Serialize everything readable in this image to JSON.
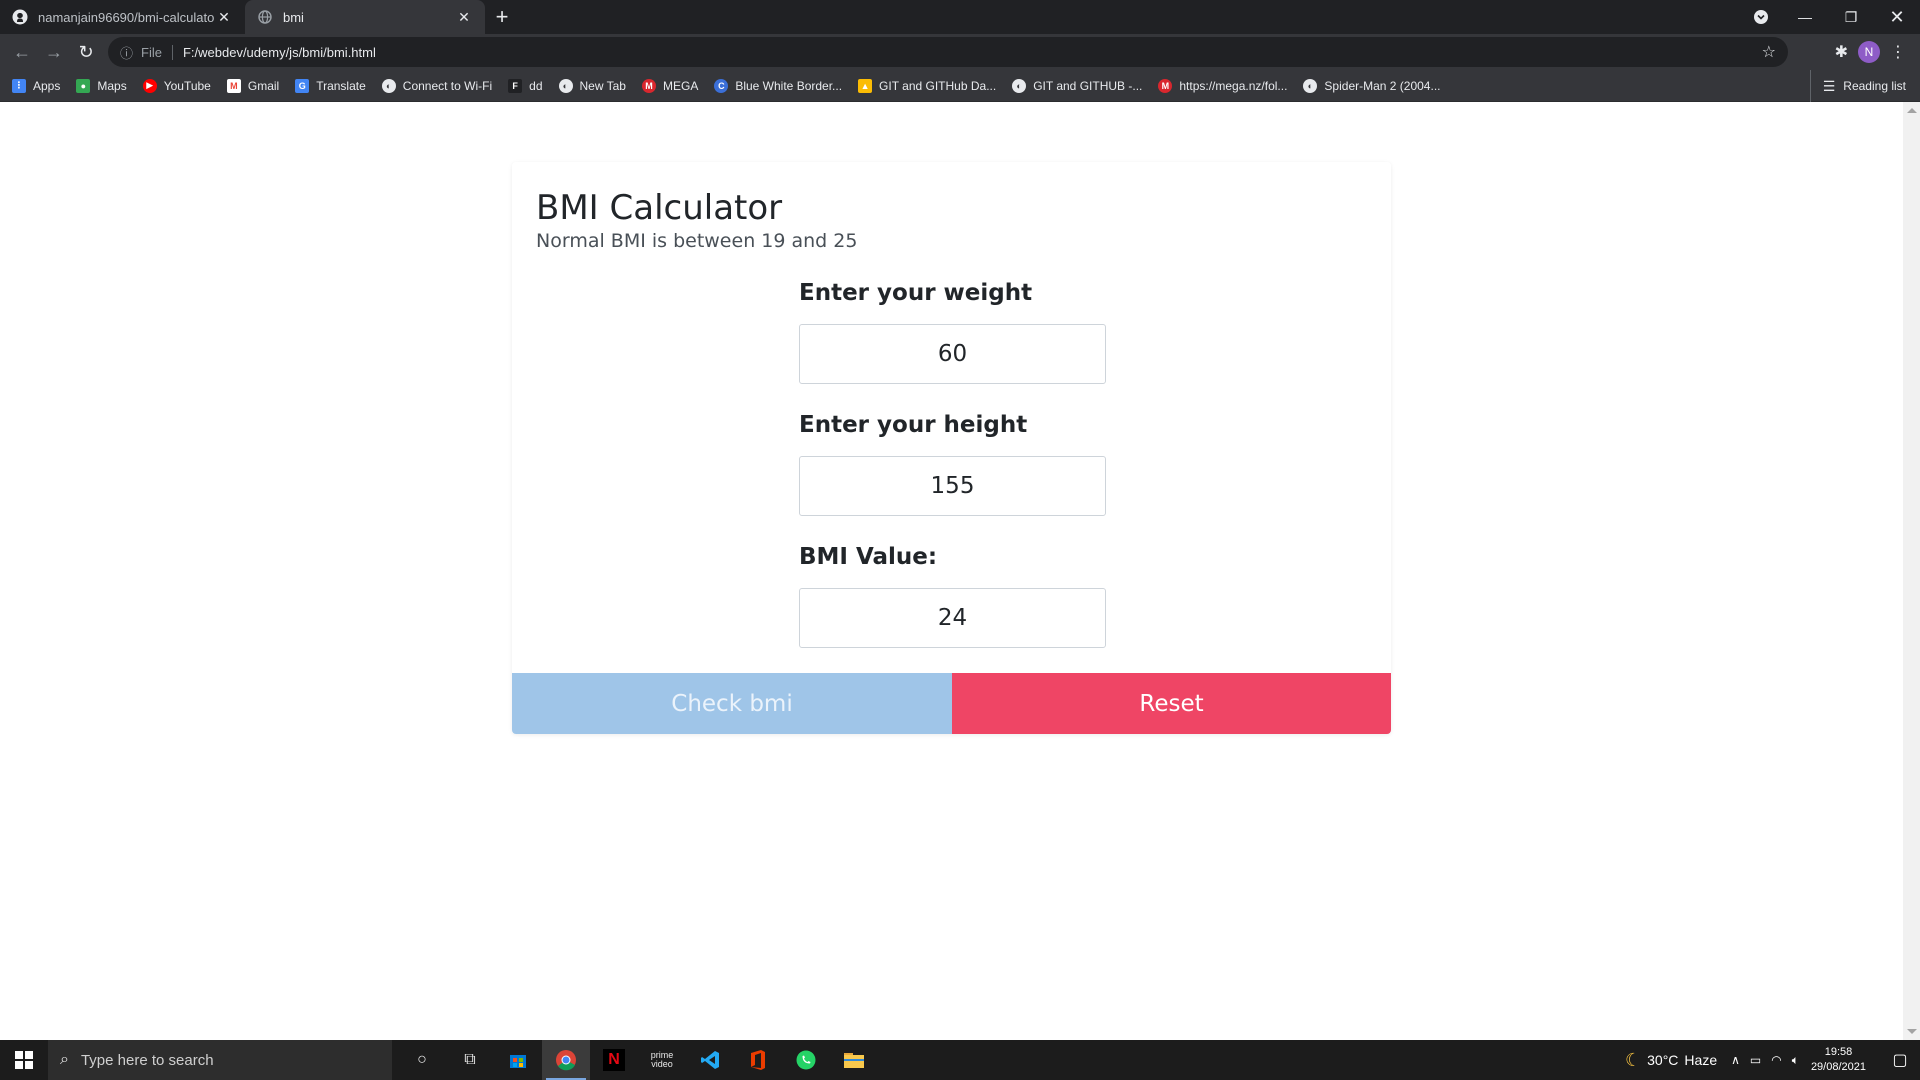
{
  "browser": {
    "tabs": [
      {
        "title": "namanjain96690/bmi-calculator",
        "icon": "github-icon",
        "active": false
      },
      {
        "title": "bmi",
        "icon": "globe-icon",
        "active": true
      }
    ],
    "address": {
      "scheme_label": "File",
      "url": "F:/webdev/udemy/js/bmi/bmi.html"
    },
    "profile_initial": "N",
    "bookmarks": [
      {
        "label": "Apps",
        "icon": "apps-grid-icon",
        "color": "#4285f4"
      },
      {
        "label": "Maps",
        "icon": "maps-pin-icon",
        "color": "#34a853"
      },
      {
        "label": "YouTube",
        "icon": "youtube-icon",
        "color": "#ff0000"
      },
      {
        "label": "Gmail",
        "icon": "gmail-icon",
        "color": "#ea4335"
      },
      {
        "label": "Translate",
        "icon": "translate-icon",
        "color": "#4285f4"
      },
      {
        "label": "Connect to Wi-Fi",
        "icon": "globe-icon",
        "color": "#e8eaed"
      },
      {
        "label": "dd",
        "icon": "flag-icon",
        "color": "#202124"
      },
      {
        "label": "New Tab",
        "icon": "globe-icon",
        "color": "#e8eaed"
      },
      {
        "label": "MEGA",
        "icon": "mega-icon",
        "color": "#d9272e"
      },
      {
        "label": "Blue White Border...",
        "icon": "c-icon",
        "color": "#3b6fd8"
      },
      {
        "label": "GIT and GITHub Da...",
        "icon": "drive-icon",
        "color": "#fbbc04"
      },
      {
        "label": "GIT and GITHUB -...",
        "icon": "globe-icon",
        "color": "#e8eaed"
      },
      {
        "label": "https://mega.nz/fol...",
        "icon": "mega-icon",
        "color": "#d9272e"
      },
      {
        "label": "Spider-Man 2 (2004...",
        "icon": "globe-icon",
        "color": "#e8eaed"
      }
    ],
    "reading_list": "Reading list"
  },
  "page": {
    "title": "BMI Calculator",
    "subtitle": "Normal BMI is between 19 and 25",
    "weight": {
      "label": "Enter your weight",
      "value": "60"
    },
    "height": {
      "label": "Enter your height",
      "value": "155"
    },
    "bmi": {
      "label": "BMI Value:",
      "value": "24"
    },
    "buttons": {
      "check": "Check bmi",
      "reset": "Reset"
    },
    "colors": {
      "check": "#9fc5e8",
      "reset": "#ef4565"
    }
  },
  "taskbar": {
    "search_placeholder": "Type here to search",
    "weather": {
      "temp": "30°C",
      "condition": "Haze"
    },
    "time": "19:58",
    "date": "29/08/2021"
  }
}
